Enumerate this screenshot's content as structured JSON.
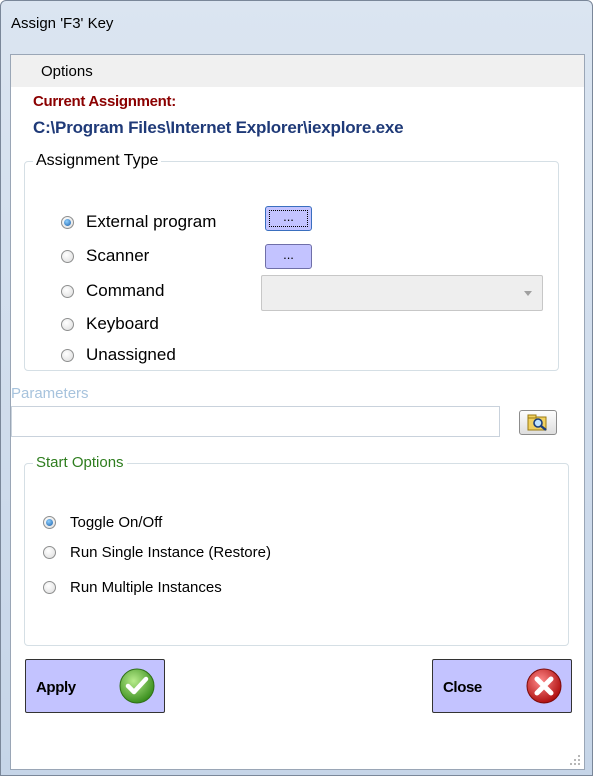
{
  "window": {
    "title": "Assign 'F3' Key"
  },
  "menu": {
    "options": "Options"
  },
  "current": {
    "label": "Current Assignment:",
    "path": "C:\\Program Files\\Internet Explorer\\iexplore.exe"
  },
  "assignment_type": {
    "title": "Assignment Type",
    "options": [
      {
        "label": "External program",
        "selected": true
      },
      {
        "label": "Scanner",
        "selected": false
      },
      {
        "label": "Command",
        "selected": false
      },
      {
        "label": "Keyboard",
        "selected": false
      },
      {
        "label": "Unassigned",
        "selected": false
      }
    ],
    "browse_label": "...",
    "command_value": ""
  },
  "parameters": {
    "label": "Parameters",
    "value": ""
  },
  "start_options": {
    "title": "Start Options",
    "options": [
      {
        "label": "Toggle On/Off",
        "selected": true
      },
      {
        "label": "Run Single Instance (Restore)",
        "selected": false
      },
      {
        "label": "Run Multiple Instances",
        "selected": false
      }
    ]
  },
  "buttons": {
    "apply": "Apply",
    "close": "Close"
  },
  "colors": {
    "button_bg": "#c3c3ff",
    "current_label": "#8b0000",
    "current_path": "#1f3a78",
    "start_title": "#2e7d1e",
    "params_label": "#a7c3dd"
  }
}
